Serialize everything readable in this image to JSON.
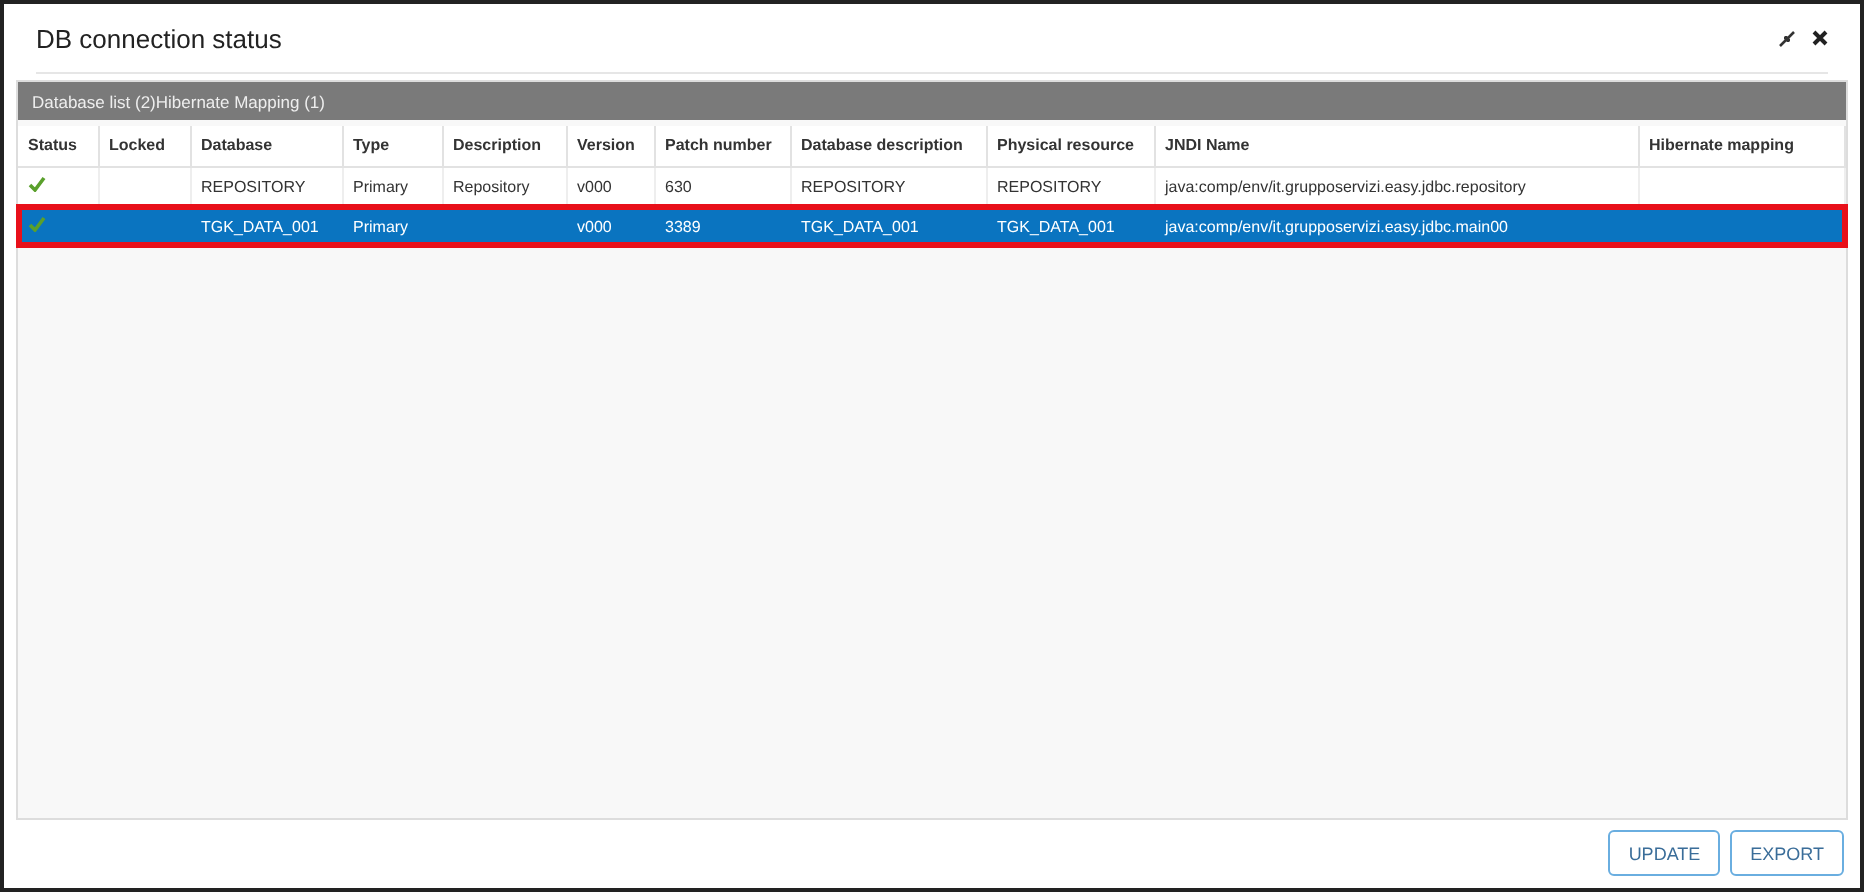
{
  "window": {
    "title": "DB connection status"
  },
  "panel": {
    "title": "Database list (2)Hibernate Mapping (1)"
  },
  "table": {
    "columns": [
      "Status",
      "Locked",
      "Database",
      "Type",
      "Description",
      "Version",
      "Patch number",
      "Database description",
      "Physical resource",
      "JNDI Name",
      "Hibernate mapping"
    ],
    "rows": [
      {
        "status_ok": true,
        "selected": false,
        "cells": [
          "",
          "",
          "REPOSITORY",
          "Primary",
          "Repository",
          "v000",
          "630",
          "REPOSITORY",
          "REPOSITORY",
          "java:comp/env/it.grupposervizi.easy.jdbc.repository",
          ""
        ]
      },
      {
        "status_ok": true,
        "selected": true,
        "cells": [
          "",
          "",
          "TGK_DATA_001",
          "Primary",
          "",
          "v000",
          "3389",
          "TGK_DATA_001",
          "TGK_DATA_001",
          "java:comp/env/it.grupposervizi.easy.jdbc.main00",
          ""
        ]
      }
    ]
  },
  "buttons": [
    "UPDATE",
    "EXPORT"
  ]
}
